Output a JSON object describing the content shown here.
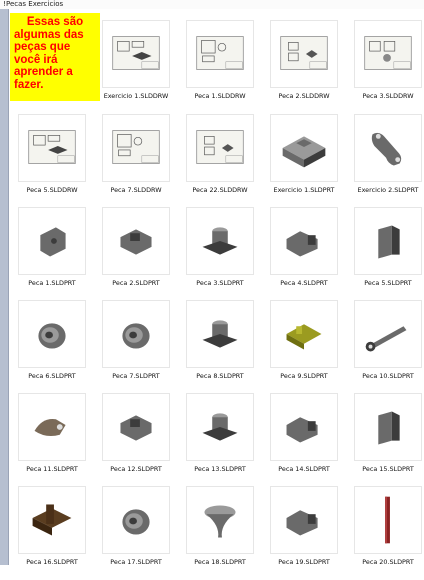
{
  "window": {
    "title": "Pecas Exercicios",
    "title_mark": "!"
  },
  "note": {
    "lines": [
      "Essas são",
      "algumas das",
      "peças que",
      "você irá",
      "aprender a",
      "fazer."
    ],
    "bg": "#ffff00",
    "color": "#ff0000"
  },
  "files": [
    {
      "name": "Exercicio 1.SLDDRW",
      "icon": "drawing-thumbnail-icon"
    },
    {
      "name": "Peca 1.SLDDRW",
      "icon": "drawing-thumbnail-icon"
    },
    {
      "name": "Peca 2.SLDDRW",
      "icon": "drawing-thumbnail-icon"
    },
    {
      "name": "Peca 3.SLDDRW",
      "icon": "drawing-thumbnail-icon"
    },
    {
      "name": "Peca 5.SLDDRW",
      "icon": "drawing-thumbnail-icon"
    },
    {
      "name": "Peca 7.SLDDRW",
      "icon": "drawing-thumbnail-icon"
    },
    {
      "name": "Peca 22.SLDDRW",
      "icon": "drawing-thumbnail-icon"
    },
    {
      "name": "Exercicio 1.SLDPRT",
      "icon": "block-part-icon"
    },
    {
      "name": "Exercicio 2.SLDPRT",
      "icon": "bracket-part-icon"
    },
    {
      "name": "Peca 1.SLDPRT",
      "icon": "part-thumbnail-icon"
    },
    {
      "name": "Peca 2.SLDPRT",
      "icon": "part-thumbnail-icon"
    },
    {
      "name": "Peca 3.SLDPRT",
      "icon": "part-thumbnail-icon"
    },
    {
      "name": "Peca 4.SLDPRT",
      "icon": "part-thumbnail-icon"
    },
    {
      "name": "Peca 5.SLDPRT",
      "icon": "part-thumbnail-icon"
    },
    {
      "name": "Peca 6.SLDPRT",
      "icon": "pulley-part-icon"
    },
    {
      "name": "Peca 7.SLDPRT",
      "icon": "pulley-part-icon"
    },
    {
      "name": "Peca 8.SLDPRT",
      "icon": "part-thumbnail-icon"
    },
    {
      "name": "Peca 9.SLDPRT",
      "icon": "part-thumbnail-icon"
    },
    {
      "name": "Peca 10.SLDPRT",
      "icon": "wrench-part-icon"
    },
    {
      "name": "Peca 11.SLDPRT",
      "icon": "part-thumbnail-icon"
    },
    {
      "name": "Peca 12.SLDPRT",
      "icon": "part-thumbnail-icon"
    },
    {
      "name": "Peca 13.SLDPRT",
      "icon": "part-thumbnail-icon"
    },
    {
      "name": "Peca 14.SLDPRT",
      "icon": "part-thumbnail-icon"
    },
    {
      "name": "Peca 15.SLDPRT",
      "icon": "part-thumbnail-icon"
    },
    {
      "name": "Peca 16.SLDPRT",
      "icon": "part-thumbnail-icon"
    },
    {
      "name": "Peca 17.SLDPRT",
      "icon": "pulley-part-icon"
    },
    {
      "name": "Peca 18.SLDPRT",
      "icon": "funnel-part-icon"
    },
    {
      "name": "Peca 19.SLDPRT",
      "icon": "part-thumbnail-icon"
    },
    {
      "name": "Peca 20.SLDPRT",
      "icon": "rod-part-icon"
    }
  ]
}
